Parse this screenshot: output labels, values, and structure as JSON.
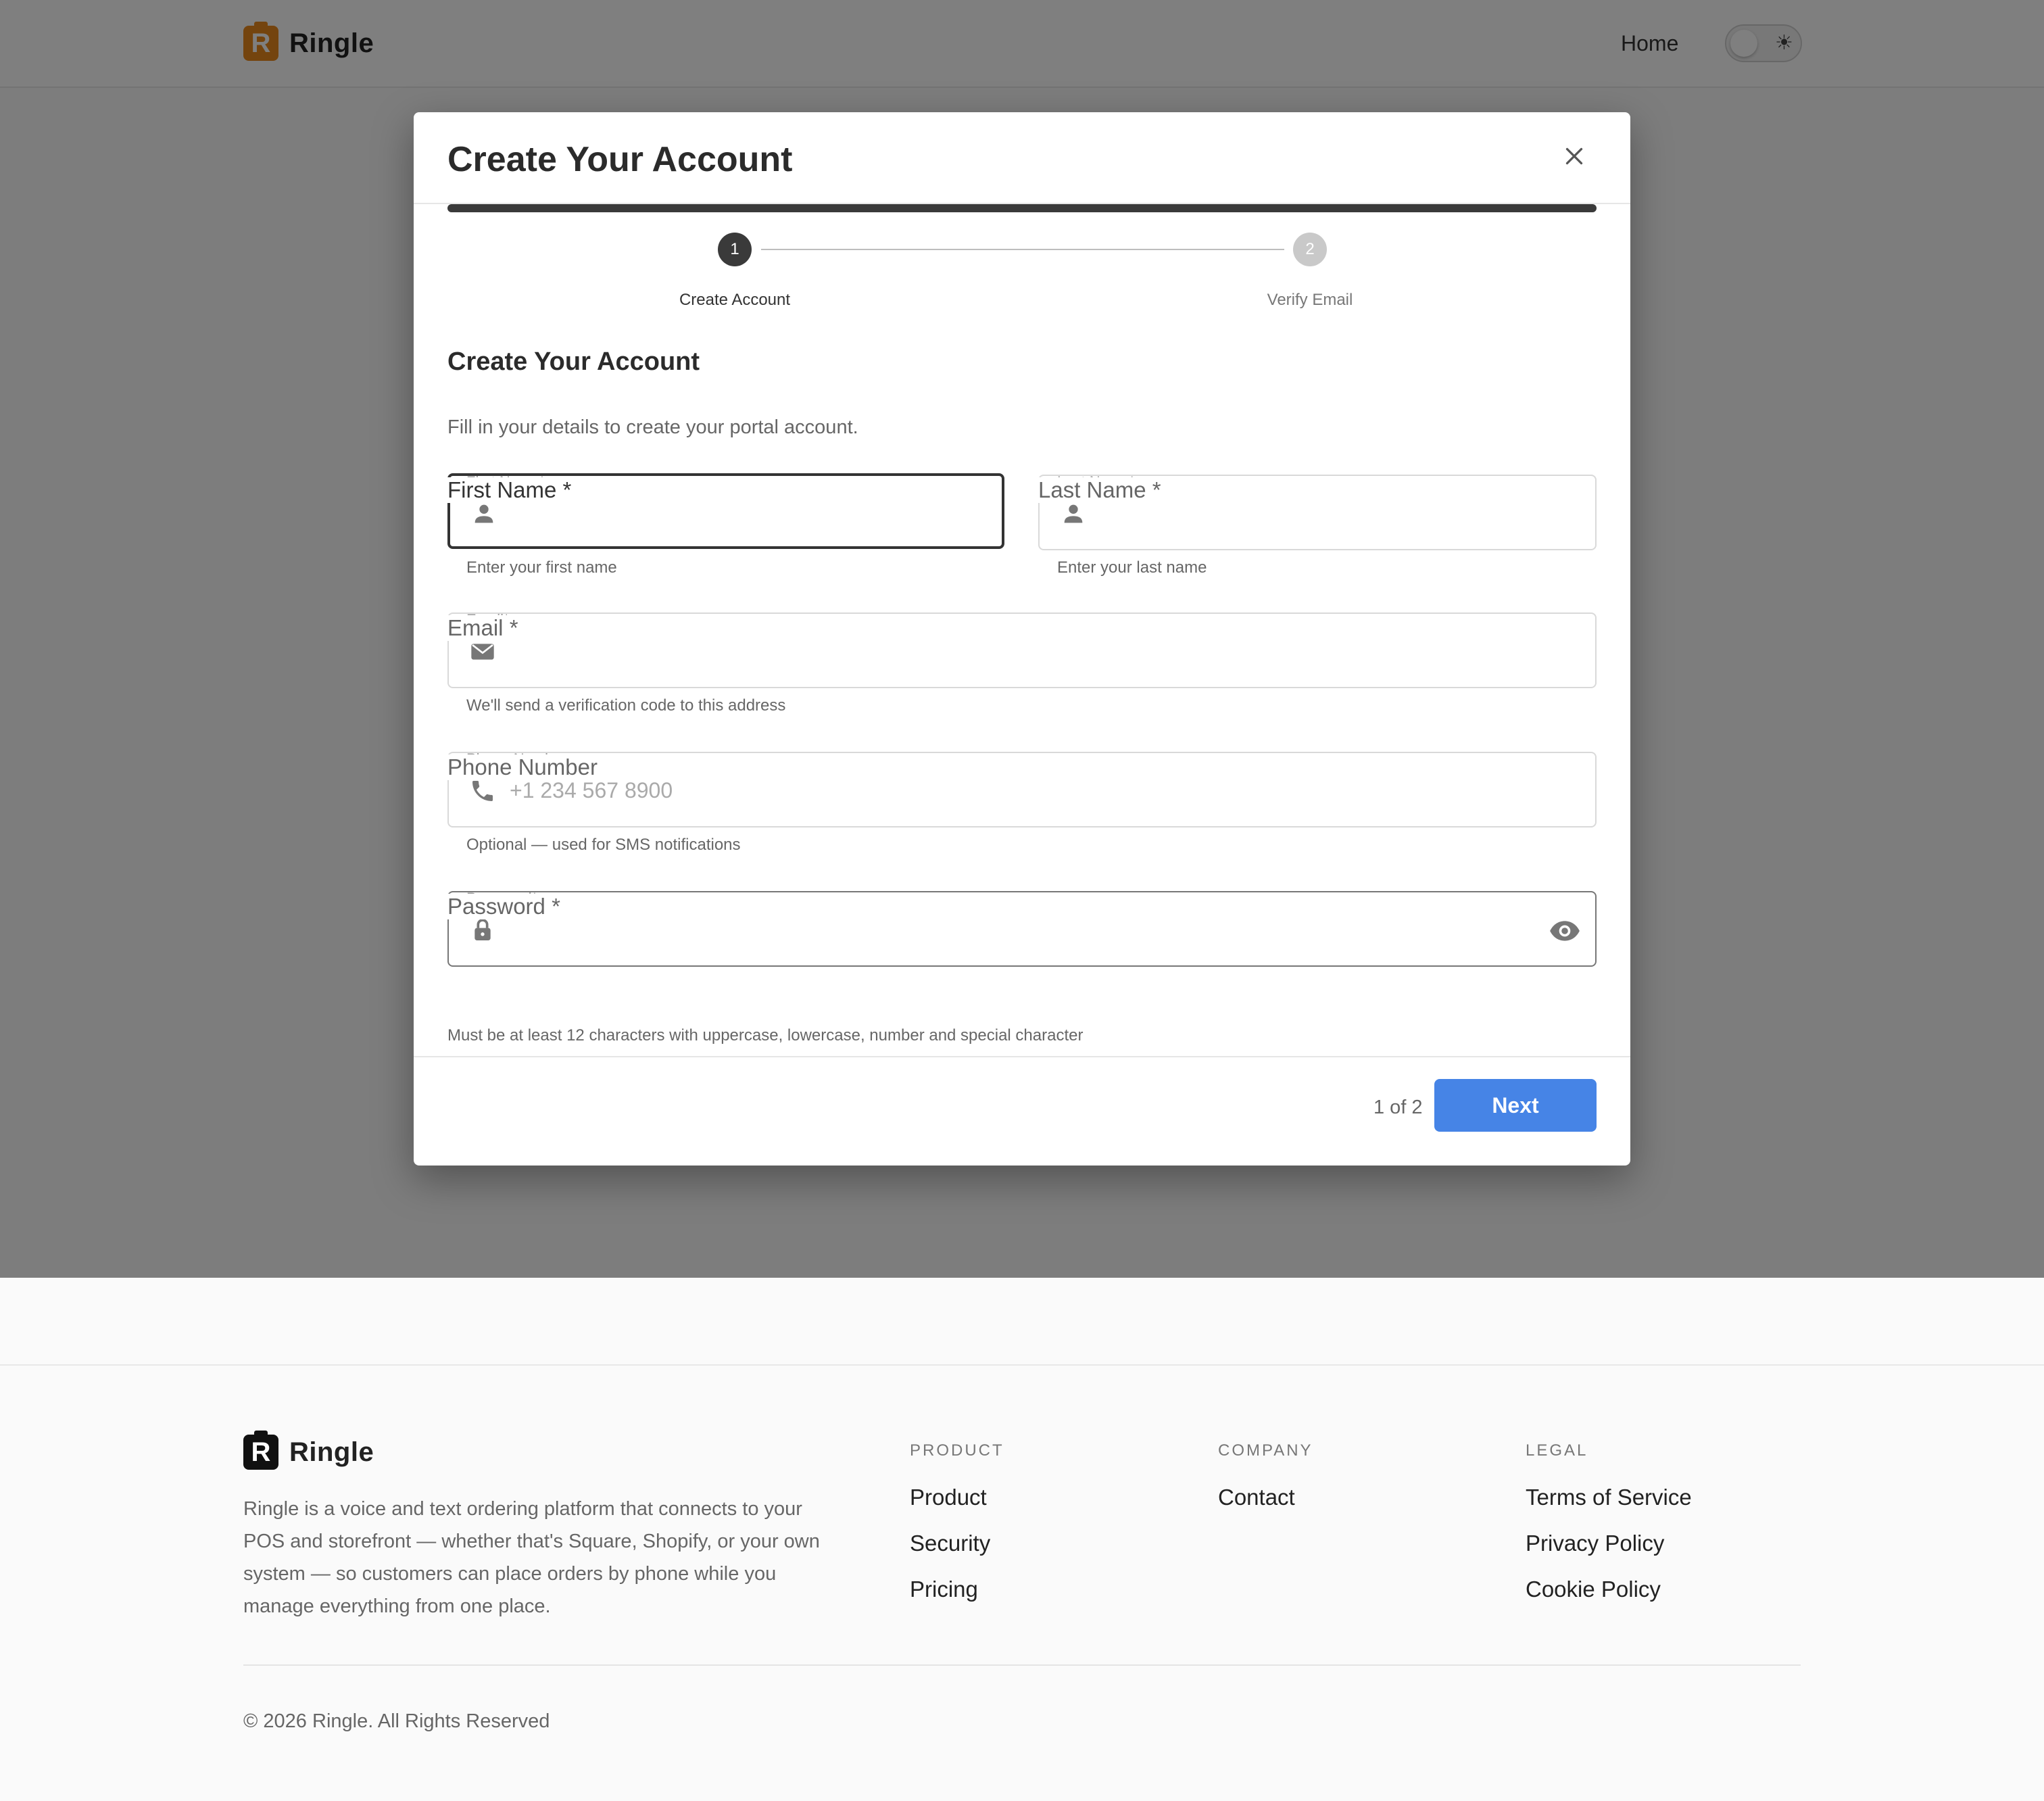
{
  "app": {
    "brand_name": "Ringle",
    "logo_letter": "R"
  },
  "topnav": {
    "home_label": "Home",
    "theme_toggle_icon": "sun-icon"
  },
  "modal": {
    "title": "Create Your Account",
    "progress_percent": 100,
    "steps": [
      {
        "number": "1",
        "label": "Create Account",
        "active": true
      },
      {
        "number": "2",
        "label": "Verify Email",
        "active": false
      }
    ],
    "section_title": "Create Your Account",
    "section_desc": "Fill in your details to create your portal account.",
    "fields": {
      "first_name": {
        "label": "First Name",
        "required_mark": "*",
        "value": "",
        "placeholder": "",
        "helper": "Enter your first name",
        "icon": "person-icon"
      },
      "last_name": {
        "label": "Last Name",
        "required_mark": "*",
        "value": "",
        "placeholder": "",
        "helper": "Enter your last name",
        "icon": "person-icon"
      },
      "email": {
        "label": "Email",
        "required_mark": "*",
        "value": "",
        "placeholder": "",
        "helper": "We'll send a verification code to this address",
        "icon": "mail-icon"
      },
      "phone": {
        "label": "Phone Number",
        "value": "",
        "placeholder": "+1 234 567 8900",
        "helper": "Optional — used for SMS notifications",
        "icon": "phone-icon"
      },
      "password": {
        "label": "Password",
        "required_mark": "*",
        "value": "",
        "placeholder": "",
        "helper": "Must be at least 12 characters with uppercase, lowercase, number and special character",
        "icon": "lock-icon",
        "toggle_icon": "eye-icon"
      }
    },
    "footer": {
      "page_count": "1 of 2",
      "next_label": "Next"
    }
  },
  "footer": {
    "brand_name": "Ringle",
    "description": "Ringle is a voice and text ordering platform that connects to your POS and storefront — whether that's Square, Shopify, or your own system — so customers can place orders by phone while you manage everything from one place.",
    "columns": [
      {
        "heading": "PRODUCT",
        "links": [
          "Product",
          "Security",
          "Pricing"
        ]
      },
      {
        "heading": "COMPANY",
        "links": [
          "Contact"
        ]
      },
      {
        "heading": "LEGAL",
        "links": [
          "Terms of Service",
          "Privacy Policy",
          "Cookie Policy"
        ]
      }
    ],
    "copyright": "© 2026 Ringle. All Rights Reserved"
  },
  "colors": {
    "accent": "#4684e6",
    "logo_orange": "#e8891c",
    "step_active": "#3a3a3a",
    "step_inactive": "#c9c9c9"
  }
}
